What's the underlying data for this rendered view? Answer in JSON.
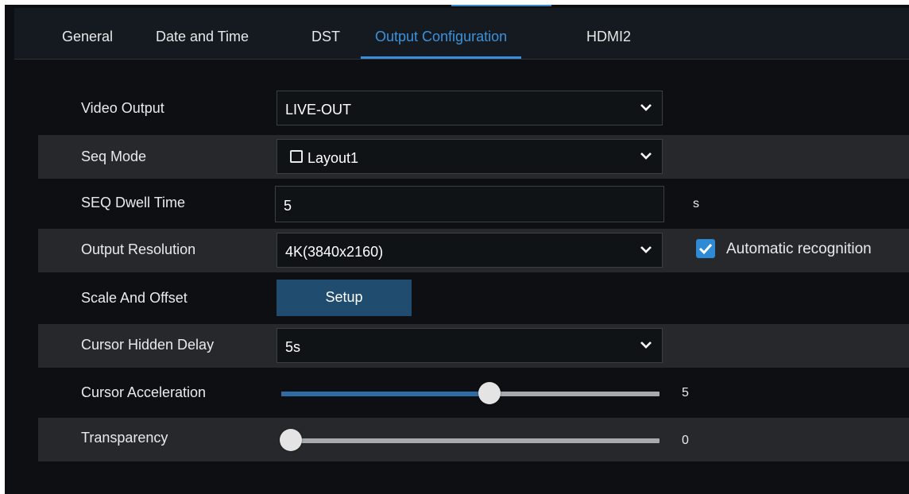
{
  "tabs": [
    {
      "label": "General"
    },
    {
      "label": "Date and Time"
    },
    {
      "label": "DST"
    },
    {
      "label": "Output Configuration",
      "active": true
    },
    {
      "label": "HDMI2"
    }
  ],
  "settings": {
    "video_output": {
      "label": "Video Output",
      "value": "LIVE-OUT"
    },
    "seq_mode": {
      "label": "Seq Mode",
      "value": "Layout1",
      "checked": false
    },
    "seq_dwell_time": {
      "label": "SEQ Dwell Time",
      "value": "5",
      "unit": "s"
    },
    "output_resolution": {
      "label": "Output Resolution",
      "value": "4K(3840x2160)",
      "auto_label": "Automatic recognition",
      "auto_checked": true
    },
    "scale_and_offset": {
      "label": "Scale And Offset",
      "button": "Setup"
    },
    "cursor_hidden_delay": {
      "label": "Cursor Hidden Delay",
      "value": "5s"
    },
    "cursor_acceleration": {
      "label": "Cursor Acceleration",
      "value": "5",
      "level": 0.55
    },
    "transparency": {
      "label": "Transparency",
      "value": "0",
      "level": 0.0
    }
  },
  "colors": {
    "accent": "#3b8fd9",
    "background": "#0d0f12",
    "row_alt": "#26282b",
    "button": "#1f4c6f",
    "slider_fill": "#2e6ca6"
  },
  "icons": {
    "dropdown": "chevron-down-icon",
    "checkbox_on": "checkmark-icon",
    "checkbox_off": "empty-checkbox-icon"
  }
}
